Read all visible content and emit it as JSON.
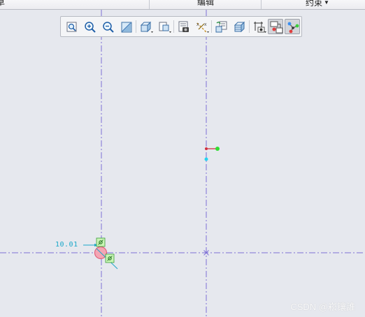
{
  "ribbon": {
    "tab_left_partial": "草",
    "tab_edit": "编辑",
    "tab_constraints": "约束"
  },
  "toolbar": {
    "buttons": [
      {
        "icon": "refit-icon"
      },
      {
        "icon": "zoom-in-icon"
      },
      {
        "icon": "zoom-out-icon"
      },
      {
        "icon": "repaint-icon"
      },
      {
        "icon": "display-style-icon"
      },
      {
        "icon": "saved-orientations-icon"
      },
      {
        "icon": "view-manager-icon"
      },
      {
        "icon": "datum-display-icon"
      },
      {
        "icon": "spin-center-icon"
      },
      {
        "icon": "sketch-view-icon"
      },
      {
        "icon": "sketcher-display-icon"
      },
      {
        "icon": "disp-constraints-icon",
        "active": true
      },
      {
        "icon": "disp-vertices-icon",
        "active": true
      }
    ]
  },
  "sketch": {
    "dimension_text": "10.01",
    "colors": {
      "centerline": "#7e6fd6",
      "dimension": "#1aa7c9",
      "constraint_fill": "#c9f5b5",
      "constraint_stroke": "#3a9b3a",
      "circle_fill": "#f4a6b4",
      "circle_stroke": "#e0607a",
      "green_point": "#33dd33",
      "cyan_point": "#24d4f0",
      "red_segment": "#d03040"
    }
  },
  "watermark": {
    "text": "CSDN @崧镶誰"
  }
}
